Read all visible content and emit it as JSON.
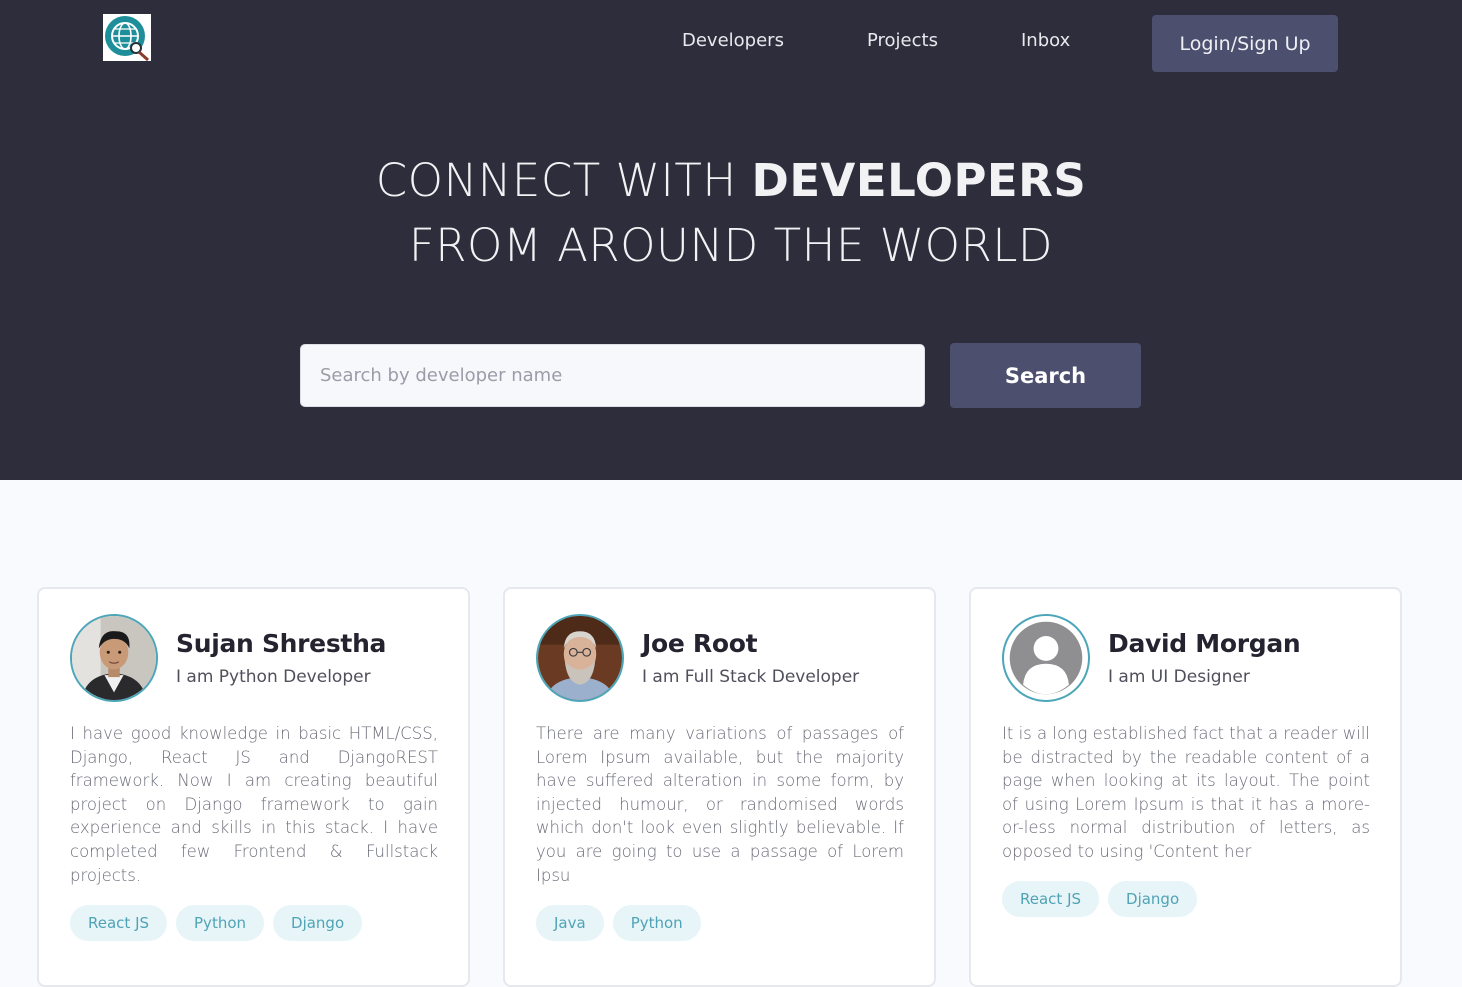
{
  "nav": {
    "links": [
      "Developers",
      "Projects",
      "Inbox"
    ],
    "login_label": "Login/Sign Up"
  },
  "hero": {
    "headline_light": "CONNECT WITH ",
    "headline_bold": "DEVELOPERS",
    "headline_line2": "FROM AROUND THE WORLD",
    "search_placeholder": "Search by developer name",
    "search_button": "Search"
  },
  "developers": [
    {
      "name": "Sujan Shrestha",
      "role": "I am Python Developer",
      "bio": "I have good knowledge in basic HTML/CSS, Django, React JS and DjangoREST framework. Now I am creating beautiful project on Django framework to gain experience and skills in this stack. I have completed few Frontend & Fullstack projects.",
      "skills": [
        "React JS",
        "Python",
        "Django"
      ],
      "avatar": "photo-young-man"
    },
    {
      "name": "Joe Root",
      "role": "I am Full Stack Developer",
      "bio": "There are many variations of passages of Lorem Ipsum available, but the majority have suffered alteration in some form, by injected humour, or randomised words which don't look even slightly believable. If you are going to use a passage of Lorem Ipsu",
      "skills": [
        "Java",
        "Python"
      ],
      "avatar": "photo-bearded-man"
    },
    {
      "name": "David Morgan",
      "role": "I am UI Designer",
      "bio": "It is a long established fact that a reader will be distracted by the readable content of a page when looking at its layout. The point of using Lorem Ipsum is that it has a more-or-less normal distribution of letters, as opposed to using 'Content her",
      "skills": [
        "React JS",
        "Django"
      ],
      "avatar": "default-user-icon"
    }
  ],
  "colors": {
    "hero_bg": "#2e2d3b",
    "button_bg": "#4d4f6e",
    "tag_bg": "#e7f5f8",
    "tag_text": "#4fa3b5",
    "avatar_ring": "#4aa6b8"
  }
}
